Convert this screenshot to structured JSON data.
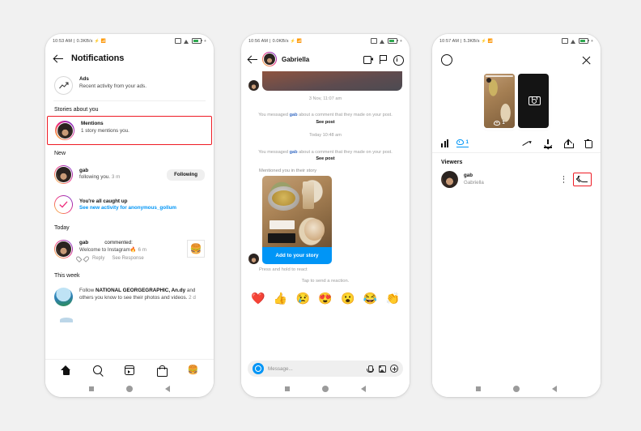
{
  "phone1": {
    "status": {
      "time": "10:53 AM",
      "speed": "0.3KB/s",
      "sep": "|",
      "plus": "+"
    },
    "header": {
      "title": "Notifications",
      "back_icon": "back-arrow-icon"
    },
    "items": {
      "ads": {
        "title": "Ads",
        "subtitle": "Recent activity from your ads."
      },
      "section_stories": "Stories about you",
      "mentions": {
        "title": "Mentions",
        "subtitle": "1 story mentions you."
      },
      "section_new": "New",
      "follow": {
        "name": "gab",
        "text": "following you.",
        "time": "3 m",
        "button": "Following"
      },
      "caught_up": {
        "title": "You're all caught up",
        "link": "See new activity for anonymous_gollum"
      },
      "section_today": "Today",
      "comment": {
        "name": "gab",
        "action": "commented:",
        "text": "Welcome to Instagram🔥",
        "time": "6 m",
        "like": "Like",
        "reply": "Reply",
        "see_response": "See Response",
        "thumb": "🍔"
      },
      "section_week": "This week",
      "suggestion": {
        "prefix": "Follow ",
        "bold": "NATIONAL GEORGEGRAPHIC, An.dy",
        "rest": " and others you know to see their photos and videos.",
        "time": "2 d"
      }
    },
    "tabbar": [
      "home-icon",
      "search-icon",
      "reels-icon",
      "shop-icon",
      "profile-avatar"
    ]
  },
  "phone2": {
    "status": {
      "time": "10:56 AM",
      "speed": "0.0KB/s",
      "sep": "|",
      "plus": "+"
    },
    "header": {
      "name": "Gabriella",
      "video_icon": "video-camera-icon",
      "flag_icon": "flag-icon",
      "info_icon": "info-icon"
    },
    "thread": {
      "date1": "3 Nov, 11:07 am",
      "sys1_prefix": "You messaged ",
      "sys1_user": "gab",
      "sys1_mid": " about a comment that they made on your post. ",
      "sys1_link": "See post",
      "date2": "Today 10:48 am",
      "sys2_prefix": "You messaged ",
      "sys2_user": "gab",
      "sys2_mid": " about a comment that they made on your post. ",
      "sys2_link": "See post",
      "story_label": "Mentioned you in their story",
      "add_story": "Add to your story",
      "press_hold": "Press and hold to react",
      "tap_react": "Tap to send a reaction.",
      "reactions": [
        "❤️",
        "👍",
        "😢",
        "😍",
        "😮",
        "😂",
        "👏"
      ]
    },
    "composer": {
      "placeholder": "Message...",
      "camera_icon": "camera-icon",
      "mic_icon": "microphone-icon",
      "gallery_icon": "gallery-icon",
      "plus_icon": "plus-circle-icon"
    }
  },
  "phone3": {
    "status": {
      "time": "10:57 AM",
      "speed": "5.3KB/s",
      "sep": "|",
      "plus": "+"
    },
    "header": {
      "ring_icon": "story-ring-icon",
      "close_icon": "close-icon"
    },
    "tray": {
      "view_count": "1",
      "eye_icon": "eye-icon",
      "camera_icon": "camera-icon"
    },
    "toolbar": {
      "insights_icon": "bar-chart-icon",
      "viewers_count": "1",
      "trend_icon": "trending-up-icon",
      "download_icon": "download-icon",
      "share_icon": "share-icon",
      "delete_icon": "trash-icon"
    },
    "viewers": {
      "heading": "Viewers",
      "rows": [
        {
          "name": "gab",
          "subtitle": "Gabriella",
          "more_icon": "kebab-menu-icon",
          "reply_icon": "reply-arrow-icon"
        }
      ]
    }
  },
  "colors": {
    "accent": "#0095f6",
    "highlight": "#ee1b24",
    "muted": "#8e8e8e",
    "battery": "#2ea84f"
  }
}
